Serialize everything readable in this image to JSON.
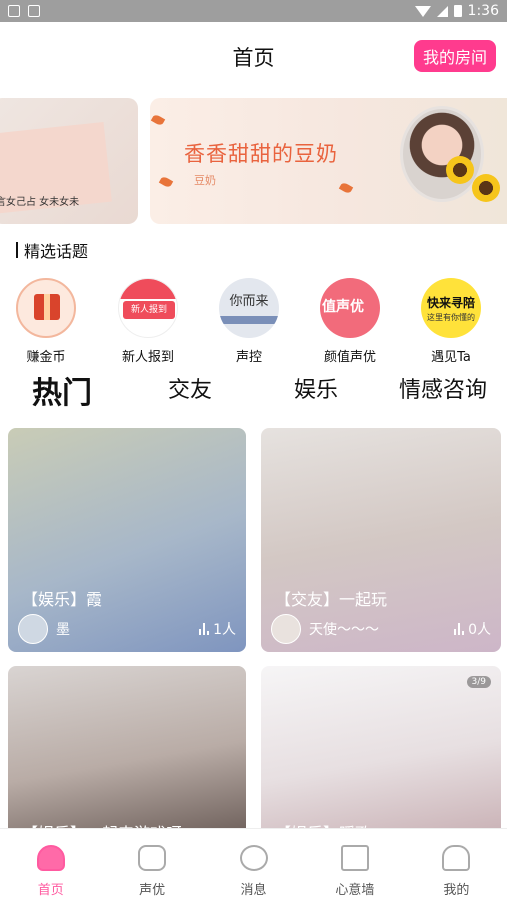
{
  "status_bar": {
    "time": "1:36"
  },
  "header": {
    "title": "首页",
    "room_button": "我的房间"
  },
  "banner": {
    "left_caption": "言女己占 女未女未",
    "main_headline": "香香甜甜的豆奶",
    "main_sub": "豆奶"
  },
  "section": {
    "title": "精选话题"
  },
  "topics": [
    {
      "label": "赚金币",
      "icon": "gift-icon"
    },
    {
      "label": "新人报到",
      "icon": "new-user-icon",
      "circle_text": "新人报到"
    },
    {
      "label": "声控",
      "icon": "voice-control-icon",
      "circle_text": "你而来"
    },
    {
      "label": "颜值声优",
      "icon": "voice-actor-icon",
      "circle_text": "值声优"
    },
    {
      "label": "遇见Ta",
      "icon": "meet-icon",
      "circle_text": "快来寻陪",
      "circle_sub": "这里有你懂的"
    }
  ],
  "tabs": [
    "热门",
    "交友",
    "娱乐",
    "情感咨询"
  ],
  "rooms": [
    {
      "title": "【娱乐】霞",
      "nickname": "墨",
      "count": "1人",
      "colors": [
        "#bfc8b5",
        "#8fa6c9"
      ]
    },
    {
      "title": "【交友】一起玩",
      "nickname": "天使～～～",
      "count": "0人",
      "colors": [
        "#d8d4d0",
        "#c9b9c9"
      ]
    },
    {
      "title": "【娱乐】一起来游戏呀",
      "nickname": "",
      "count": "",
      "colors": [
        "#cfc9c7",
        "#8d7f7a"
      ]
    },
    {
      "title": "【娱乐】暖歌",
      "nickname": "",
      "count": "",
      "badge": "3/9",
      "colors": [
        "#f2f0f2",
        "#d9c4c7"
      ]
    }
  ],
  "bottom_nav": [
    {
      "label": "首页",
      "icon": "home-icon",
      "active": true
    },
    {
      "label": "声优",
      "icon": "chat-bubbles-icon",
      "active": false
    },
    {
      "label": "消息",
      "icon": "compass-icon",
      "active": false
    },
    {
      "label": "心意墙",
      "icon": "inbox-icon",
      "active": false
    },
    {
      "label": "我的",
      "icon": "user-icon",
      "active": false
    }
  ],
  "colors": {
    "accent": "#ff3b8e",
    "nav_active": "#ff5aa0"
  }
}
